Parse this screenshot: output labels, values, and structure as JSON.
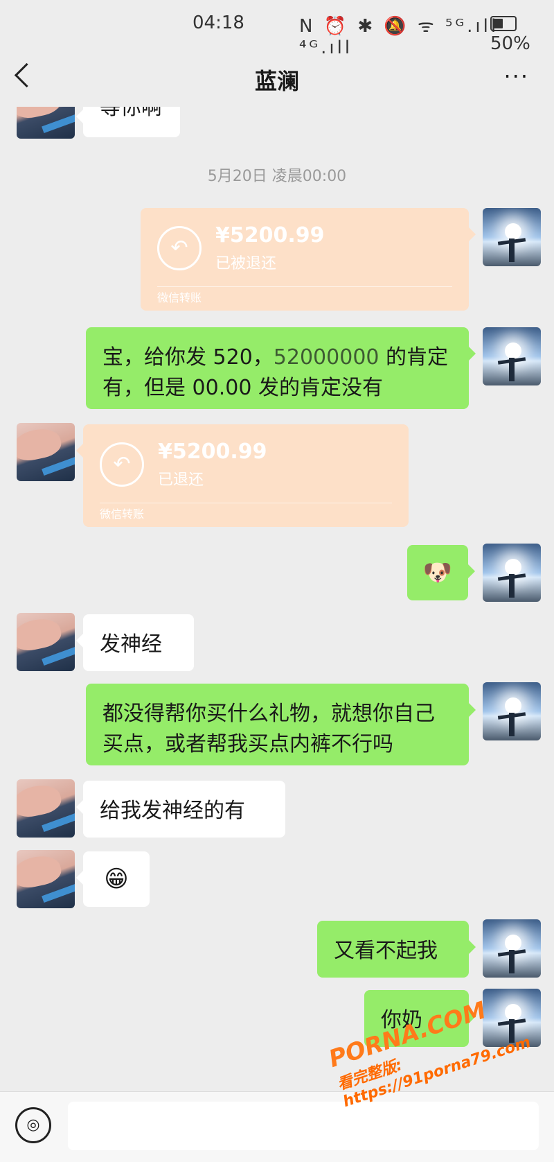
{
  "status_bar": {
    "time": "04:18",
    "icons": "N ⏰ ✱ 🔕 ᯤ ⁵ᴳ.ıll ⁴ᴳ.ıll",
    "battery": "50%"
  },
  "nav": {
    "title": "蓝澜",
    "more": "···"
  },
  "messages": {
    "m0": {
      "text": "等你啊"
    },
    "timestamp": "5月20日 凌晨00:00",
    "t1": {
      "amount": "¥5200.99",
      "status": "已被退还",
      "footer": "微信转账"
    },
    "m2": {
      "pre": "宝，给你发 520，",
      "hl": "52000000",
      "post": " 的肯定有，但是 00.00 发的肯定没有"
    },
    "t3": {
      "amount": "¥5200.99",
      "status": "已退还",
      "footer": "微信转账"
    },
    "m4": {
      "emoji": "🐶"
    },
    "m5": {
      "text": "发神经"
    },
    "m6": {
      "text": "都没得帮你买什么礼物，就想你自己买点，或者帮我买点内裤不行吗"
    },
    "m7": {
      "text": "给我发神经的有"
    },
    "m8": {
      "emoji": "😁"
    },
    "m9": {
      "text": "又看不起我"
    },
    "m10": {
      "text": "你奶"
    }
  },
  "watermark": {
    "line1": "PORNA.COM",
    "line2": "看完整版: https://91porna79.com"
  },
  "input": {
    "voice_icon": "◎"
  }
}
